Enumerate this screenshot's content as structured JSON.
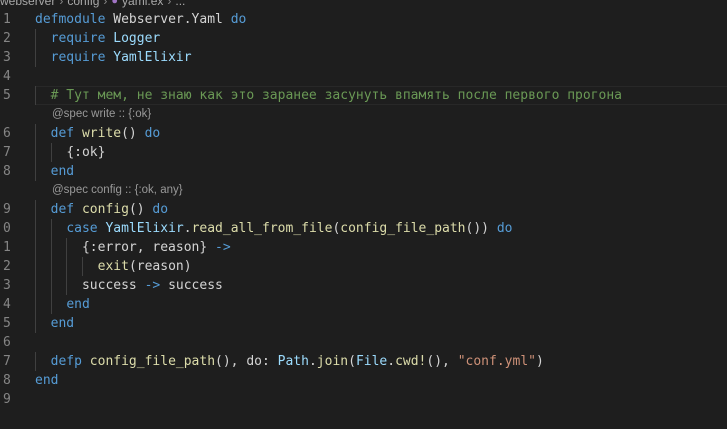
{
  "breadcrumb": {
    "parts": [
      "webserver",
      "config",
      "yaml.ex",
      "..."
    ]
  },
  "lines": [
    {
      "n": "1",
      "tokens": [
        {
          "t": "defmodule",
          "c": "k"
        },
        {
          "t": " "
        },
        {
          "t": "Webserver.Yaml",
          "c": "p"
        },
        {
          "t": " "
        },
        {
          "t": "do",
          "c": "k"
        }
      ]
    },
    {
      "n": "2",
      "tokens": [
        {
          "t": "  "
        },
        {
          "t": "require",
          "c": "k"
        },
        {
          "t": " "
        },
        {
          "t": "Logger",
          "c": "a"
        }
      ]
    },
    {
      "n": "3",
      "tokens": [
        {
          "t": "  "
        },
        {
          "t": "require",
          "c": "k"
        },
        {
          "t": " "
        },
        {
          "t": "YamlElixir",
          "c": "a"
        }
      ]
    },
    {
      "n": "4",
      "tokens": []
    },
    {
      "n": "5",
      "tokens": [
        {
          "t": "  "
        },
        {
          "t": "# Тут мем, не знаю как это заранее засунуть впамять после первого прогона",
          "c": "c"
        }
      ],
      "current": true
    },
    {
      "lens": "@spec write :: {:ok}"
    },
    {
      "n": "6",
      "tokens": [
        {
          "t": "  "
        },
        {
          "t": "def",
          "c": "k"
        },
        {
          "t": " "
        },
        {
          "t": "write",
          "c": "f"
        },
        {
          "t": "() "
        },
        {
          "t": "do",
          "c": "k"
        }
      ]
    },
    {
      "n": "7",
      "tokens": [
        {
          "t": "    "
        },
        {
          "t": "{:ok}",
          "c": "p"
        }
      ]
    },
    {
      "n": "8",
      "tokens": [
        {
          "t": "  "
        },
        {
          "t": "end",
          "c": "k"
        }
      ]
    },
    {
      "lens": "@spec config :: {:ok, any}"
    },
    {
      "n": "9",
      "tokens": [
        {
          "t": "  "
        },
        {
          "t": "def",
          "c": "k"
        },
        {
          "t": " "
        },
        {
          "t": "config",
          "c": "f"
        },
        {
          "t": "() "
        },
        {
          "t": "do",
          "c": "k"
        }
      ]
    },
    {
      "n": "0",
      "tokens": [
        {
          "t": "    "
        },
        {
          "t": "case",
          "c": "k"
        },
        {
          "t": " "
        },
        {
          "t": "YamlElixir",
          "c": "a"
        },
        {
          "t": "."
        },
        {
          "t": "read_all_from_file",
          "c": "f"
        },
        {
          "t": "("
        },
        {
          "t": "config_file_path",
          "c": "f"
        },
        {
          "t": "()) "
        },
        {
          "t": "do",
          "c": "k"
        }
      ]
    },
    {
      "n": "1",
      "tokens": [
        {
          "t": "      "
        },
        {
          "t": "{:error, reason}",
          "c": "p"
        },
        {
          "t": " "
        },
        {
          "t": "->",
          "c": "k"
        }
      ]
    },
    {
      "n": "2",
      "tokens": [
        {
          "t": "        "
        },
        {
          "t": "exit",
          "c": "f"
        },
        {
          "t": "(reason)"
        }
      ]
    },
    {
      "n": "3",
      "tokens": [
        {
          "t": "      "
        },
        {
          "t": "success",
          "c": "p"
        },
        {
          "t": " "
        },
        {
          "t": "->",
          "c": "k"
        },
        {
          "t": " "
        },
        {
          "t": "success",
          "c": "p"
        }
      ]
    },
    {
      "n": "4",
      "tokens": [
        {
          "t": "    "
        },
        {
          "t": "end",
          "c": "k"
        }
      ]
    },
    {
      "n": "5",
      "tokens": [
        {
          "t": "  "
        },
        {
          "t": "end",
          "c": "k"
        }
      ]
    },
    {
      "n": "6",
      "tokens": []
    },
    {
      "n": "7",
      "tokens": [
        {
          "t": "  "
        },
        {
          "t": "defp",
          "c": "k"
        },
        {
          "t": " "
        },
        {
          "t": "config_file_path",
          "c": "f"
        },
        {
          "t": "(), do: "
        },
        {
          "t": "Path",
          "c": "a"
        },
        {
          "t": "."
        },
        {
          "t": "join",
          "c": "f"
        },
        {
          "t": "("
        },
        {
          "t": "File",
          "c": "a"
        },
        {
          "t": "."
        },
        {
          "t": "cwd!",
          "c": "f"
        },
        {
          "t": "(), "
        },
        {
          "t": "\"conf.yml\"",
          "c": "s"
        },
        {
          "t": ")"
        }
      ]
    },
    {
      "n": "8",
      "tokens": [
        {
          "t": "end",
          "c": "k"
        }
      ]
    },
    {
      "n": "9",
      "tokens": []
    }
  ]
}
